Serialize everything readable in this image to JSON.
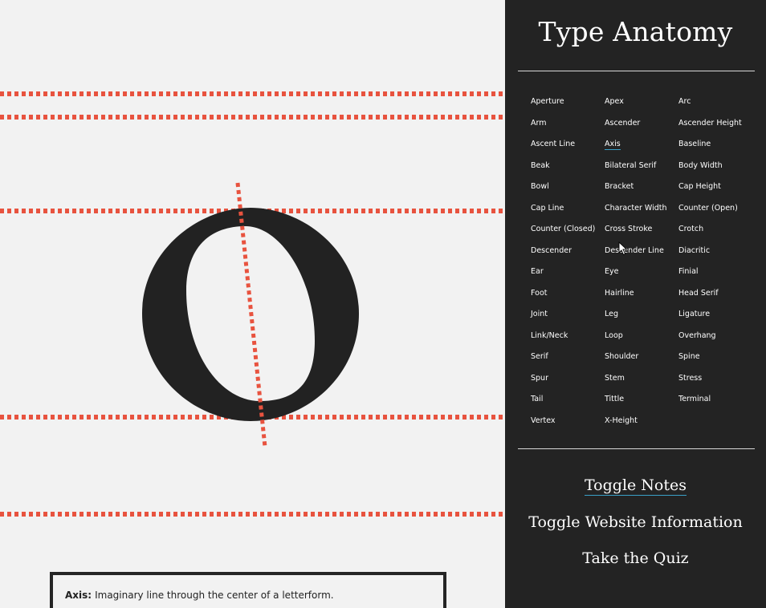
{
  "sidebar": {
    "title": "Type Anatomy",
    "terms": [
      "Aperture",
      "Apex",
      "Arc",
      "Arm",
      "Ascender",
      "Ascender Height",
      "Ascent Line",
      "Axis",
      "Baseline",
      "Beak",
      "Bilateral Serif",
      "Body Width",
      "Bowl",
      "Bracket",
      "Cap Height",
      "Cap Line",
      "Character Width",
      "Counter (Open)",
      "Counter (Closed)",
      "Cross Stroke",
      "Crotch",
      "Descender",
      "Descender Line",
      "Diacritic",
      "Ear",
      "Eye",
      "Finial",
      "Foot",
      "Hairline",
      "Head Serif",
      "Joint",
      "Leg",
      "Ligature",
      "Link/Neck",
      "Loop",
      "Overhang",
      "Serif",
      "Shoulder",
      "Spine",
      "Spur",
      "Stem",
      "Stress",
      "Tail",
      "Tittle",
      "Terminal",
      "Vertex",
      "X-Height"
    ],
    "active_term": "Axis",
    "links": {
      "toggle_notes": "Toggle Notes",
      "toggle_info": "Toggle Website Information",
      "take_quiz": "Take the Quiz"
    }
  },
  "display": {
    "glyph": "O"
  },
  "note": {
    "term": "Axis:",
    "text": "Imaginary line through the center of a letterform."
  },
  "colors": {
    "guide": "#e8533f",
    "accent_underline": "#3aa0c8",
    "sidebar_bg": "#232323",
    "canvas_bg": "#f2f2f2"
  }
}
